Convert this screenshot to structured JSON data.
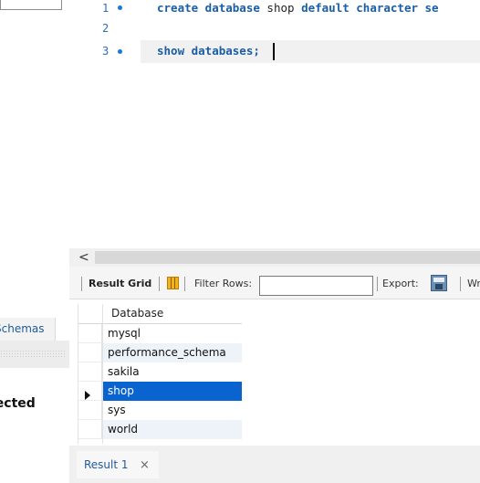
{
  "left_panel": {
    "tab_label": "Schemas",
    "selected_text": "lected"
  },
  "editor": {
    "lines": [
      {
        "number": "1",
        "has_dot": true,
        "keywords": "create database",
        "name": "shop",
        "rest": "default character se"
      },
      {
        "number": "2",
        "has_dot": false
      },
      {
        "number": "3",
        "has_dot": true,
        "keywords": "show databases;"
      }
    ]
  },
  "scrollbar": {
    "left_arrow": "<"
  },
  "result_toolbar": {
    "result_grid_label": "Result Grid",
    "filter_rows_label": "Filter Rows:",
    "filter_value": "",
    "export_label": "Export:",
    "wrap_cut": "Wr"
  },
  "result_grid": {
    "column_header": "Database",
    "rows": [
      "mysql",
      "performance_schema",
      "sakila",
      "shop",
      "sys",
      "world"
    ],
    "selected_row": "shop"
  },
  "result_tabs": [
    {
      "label": "Result 1",
      "close": "×"
    }
  ],
  "colors": {
    "keyword": "#1a5ea6",
    "line_number": "#2a6fb8",
    "selection": "#0a64cf",
    "alt_row": "#eef3f9"
  },
  "icons": [
    "grid-toggle-icon",
    "export-icon",
    "close-icon",
    "row-pointer-icon",
    "breakpoint-dot-icon"
  ]
}
